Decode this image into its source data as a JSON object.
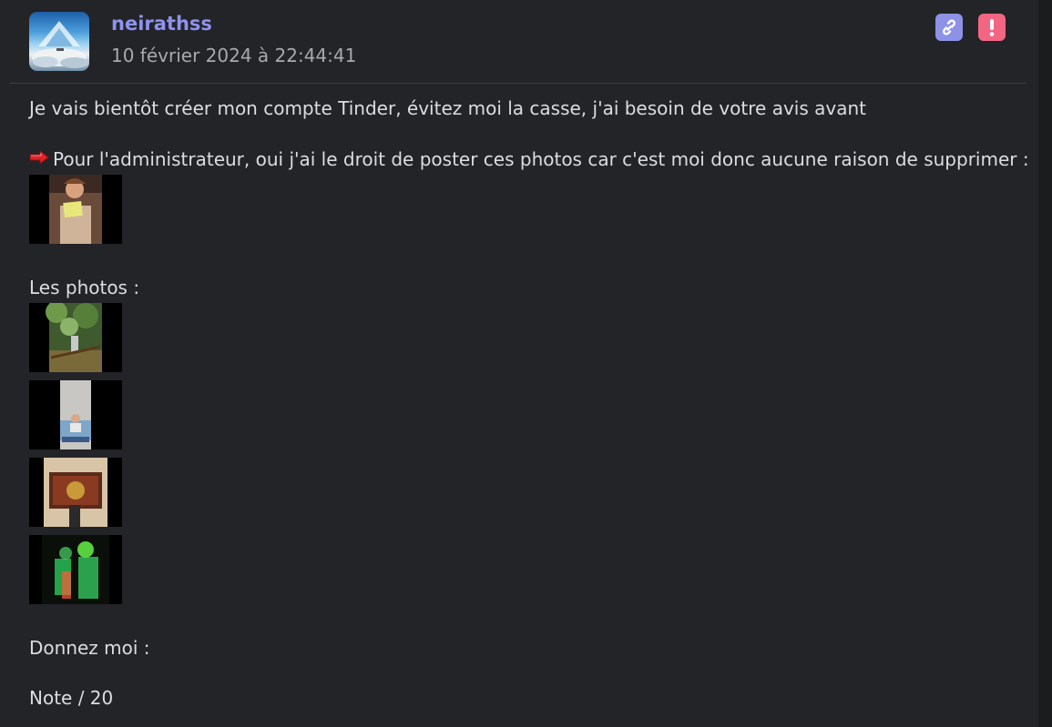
{
  "post": {
    "author": "neirathss",
    "date": "10 février 2024 à 22:44:41",
    "avatar_icon": "mountain-landscape-avatar",
    "actions": {
      "link_icon": "link-icon",
      "report_icon": "exclamation-icon"
    },
    "body": {
      "line1": "Je vais bientôt créer mon compte Tinder, évitez moi la casse, j'ai besoin de votre avis avant",
      "admin_arrow_icon": "red-arrow-icon",
      "line2": "Pour l'administrateur, oui j'ai le droit de poster ces photos car c'est moi donc aucune raison de supprimer :",
      "photos_label": "Les photos :",
      "give_label": "Donnez moi :",
      "note_label": "Note / 20"
    }
  },
  "colors": {
    "background": "#232427",
    "author": "#8e92f0",
    "link_button": "#8d92e6",
    "report_button": "#f26683",
    "text": "#dcdde0",
    "muted": "#a7a9ae"
  }
}
